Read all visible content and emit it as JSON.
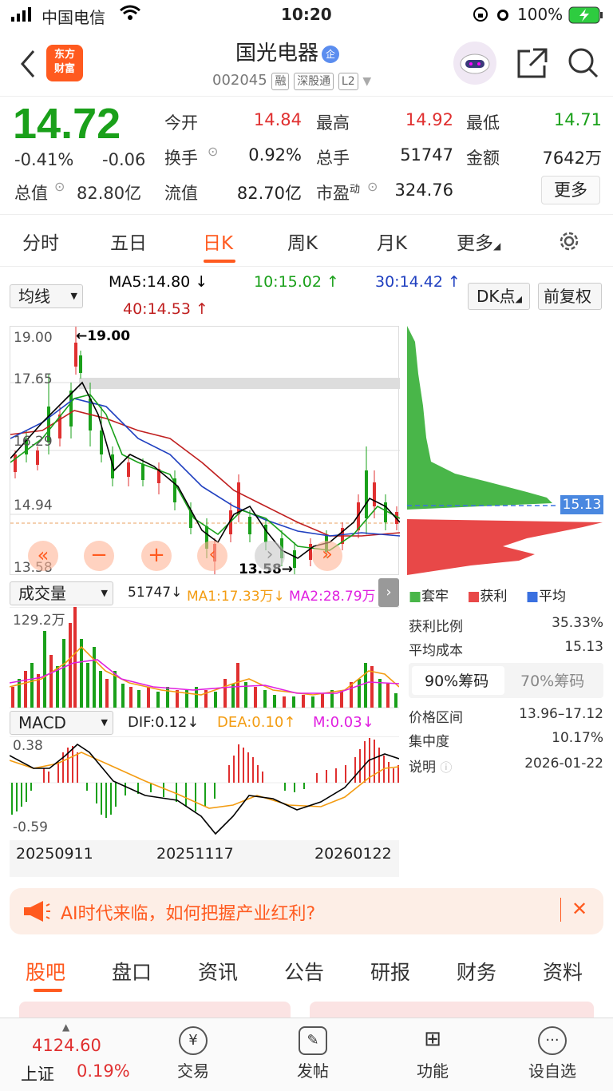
{
  "status_bar": {
    "carrier": "中国电信",
    "time": "10:20",
    "battery": "100%"
  },
  "header": {
    "stock_name": "国光电器",
    "badge": "企",
    "code": "002045",
    "tags": [
      "融",
      "深股通",
      "L2"
    ],
    "logo_line1": "东方",
    "logo_line2": "财富"
  },
  "quote": {
    "price": "14.72",
    "change_pct": "-0.41%",
    "change": "-0.06",
    "rows": [
      [
        {
          "label": "今开",
          "value": "14.84",
          "color": "red"
        },
        {
          "label": "最高",
          "value": "14.92",
          "color": "red"
        },
        {
          "label": "最低",
          "value": "14.71",
          "color": "green"
        }
      ],
      [
        {
          "label": "换手",
          "value": "0.92%",
          "color": "black"
        },
        {
          "label": "总手",
          "value": "51747",
          "color": "black"
        },
        {
          "label": "金额",
          "value": "7642万",
          "color": "black"
        }
      ]
    ],
    "total_value_label": "总值",
    "total_value": "82.80亿",
    "float_value_label": "流值",
    "float_value": "82.70亿",
    "pe_label": "市盈",
    "pe_sup": "动",
    "pe_value": "324.76",
    "more_label": "更多"
  },
  "tabs": [
    "分时",
    "五日",
    "日K",
    "周K",
    "月K",
    "更多"
  ],
  "ma_row": {
    "selector": "均线",
    "ma5": "MA5:14.80 ↓",
    "ma10": "10:15.02 ↑",
    "ma30": "30:14.42 ↑",
    "ma40": "40:14.53 ↑",
    "dk_label": "DK点",
    "fq_label": "前复权"
  },
  "kline": {
    "y_labels": [
      "19.00",
      "17.65",
      "16.29",
      "14.94",
      "13.58"
    ],
    "high_marker": "←19.00",
    "low_marker": "13.58→"
  },
  "volume": {
    "selector": "成交量",
    "vol": "51747↓",
    "ma1": "MA1:17.33万↓",
    "ma2": "MA2:28.79万↑",
    "ymax": "129.2万"
  },
  "macd": {
    "selector": "MACD",
    "dif": "DIF:0.12↓",
    "dea": "DEA:0.10↑",
    "m": "M:0.03↓",
    "ymax": "0.38",
    "ymin": "-0.59"
  },
  "dates": [
    "20250911",
    "20251117",
    "20260122"
  ],
  "chip": {
    "avg_label_value": "15.13",
    "legend": [
      "套牢",
      "获利",
      "平均"
    ],
    "rows": [
      {
        "label": "获利比例",
        "value": "35.33%"
      },
      {
        "label": "平均成本",
        "value": "15.13"
      }
    ],
    "tab_active": "90%筹码",
    "tab_other": "70%筹码",
    "rows2": [
      {
        "label": "价格区间",
        "value": "13.96–17.12"
      },
      {
        "label": "集中度",
        "value": "10.17%"
      },
      {
        "label": "说明",
        "value": "2026-01-22"
      }
    ]
  },
  "banner": {
    "text": "AI时代来临，如何把握产业红利?"
  },
  "bottom_tabs": [
    "股吧",
    "盘口",
    "资讯",
    "公告",
    "研报",
    "财务",
    "资料"
  ],
  "bottom_bar": {
    "index_value": "4124.60",
    "index_name": "上证",
    "index_change": "0.19%",
    "items": [
      "交易",
      "发帖",
      "功能",
      "设自选"
    ]
  },
  "colors": {
    "up": "#e03030",
    "down": "#1aa01a",
    "accent": "#ff5a1f",
    "ma5": "#000000",
    "ma10": "#1aa01a",
    "ma30": "#2040c0",
    "ma40": "#c02020"
  }
}
